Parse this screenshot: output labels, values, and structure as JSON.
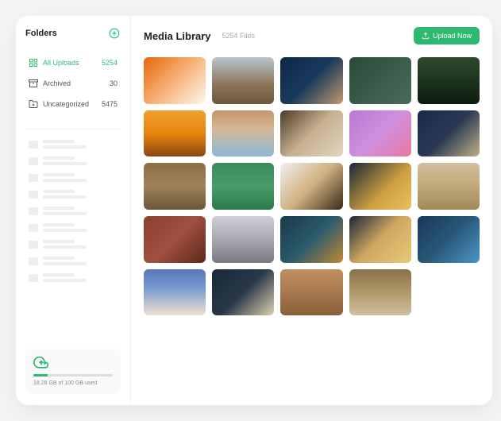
{
  "sidebar": {
    "title": "Folders",
    "items": [
      {
        "label": "All Uploads",
        "count": "5254",
        "icon": "grid-icon",
        "active": true
      },
      {
        "label": "Archived",
        "count": "30",
        "icon": "archive-icon",
        "active": false
      },
      {
        "label": "Uncategorized",
        "count": "5475",
        "icon": "folder-plus-icon",
        "active": false
      }
    ],
    "skeleton_count": 9,
    "storage": {
      "text": "18.28 GB of 100 GB used"
    }
  },
  "main": {
    "title": "Media Library",
    "file_count": "5254 Files",
    "upload_label": "Upload Now",
    "thumbnails": [
      {
        "bg": "linear-gradient(135deg,#e8650c,#f4a460 40%,#fff7f0)"
      },
      {
        "bg": "linear-gradient(180deg,#b8c5ce 0%,#8a7355 60%,#6b5842)"
      },
      {
        "bg": "linear-gradient(135deg,#0d2847,#1a3a5c 50%,#c49a6c)"
      },
      {
        "bg": "linear-gradient(135deg,#2a4a3a,#3d5f4d 60%,#4a6b5a)"
      },
      {
        "bg": "linear-gradient(180deg,#2d4a2d,#1a2f1a 60%,#0d1a0d)"
      },
      {
        "bg": "linear-gradient(180deg,#f0a030,#e8850c 50%,#8b4513)"
      },
      {
        "bg": "linear-gradient(180deg,#c4956c,#d4b896 40%,#8db8d8)"
      },
      {
        "bg": "linear-gradient(135deg,#4a3c28,#c8b090 50%,#e0d5c0)"
      },
      {
        "bg": "linear-gradient(135deg,#b878d0,#d090e0 50%,#e878a0)"
      },
      {
        "bg": "linear-gradient(135deg,#1a2845,#2a3a55 50%,#c0b088)"
      },
      {
        "bg": "linear-gradient(180deg,#8b6f47,#a0825a 50%,#6b5538)"
      },
      {
        "bg": "linear-gradient(180deg,#3a8b5a,#4a9b6a 50%,#2a7b4a)"
      },
      {
        "bg": "linear-gradient(135deg,#f0f0f0,#d0b080 50%,#3a2818)"
      },
      {
        "bg": "linear-gradient(135deg,#1a2838,#d0a040 60%,#e8c060)"
      },
      {
        "bg": "linear-gradient(180deg,#d0c0a0,#c0a878 50%,#a08858)"
      },
      {
        "bg": "linear-gradient(135deg,#8b4030,#a05040 50%,#5a2818)"
      },
      {
        "bg": "linear-gradient(180deg,#d0d0d8,#a8a8b0 50%,#787880)"
      },
      {
        "bg": "linear-gradient(135deg,#1a3a4a,#2a5a6a 50%,#c08838)"
      },
      {
        "bg": "linear-gradient(135deg,#1a2838,#d0a860 50%,#e8c878)"
      },
      {
        "bg": "linear-gradient(135deg,#183858,#2a5878 50%,#4898c8)"
      },
      {
        "bg": "linear-gradient(180deg,#5878b8,#7898d0 40%,#f0e0d0)"
      },
      {
        "bg": "linear-gradient(135deg,#1a2838,#283848 50%,#e0d0b0)"
      },
      {
        "bg": "linear-gradient(180deg,#c09060,#a87850 50%,#886038)"
      },
      {
        "bg": "linear-gradient(180deg,#8a704a,#b0986a 50%,#d0c0a0)"
      }
    ]
  }
}
